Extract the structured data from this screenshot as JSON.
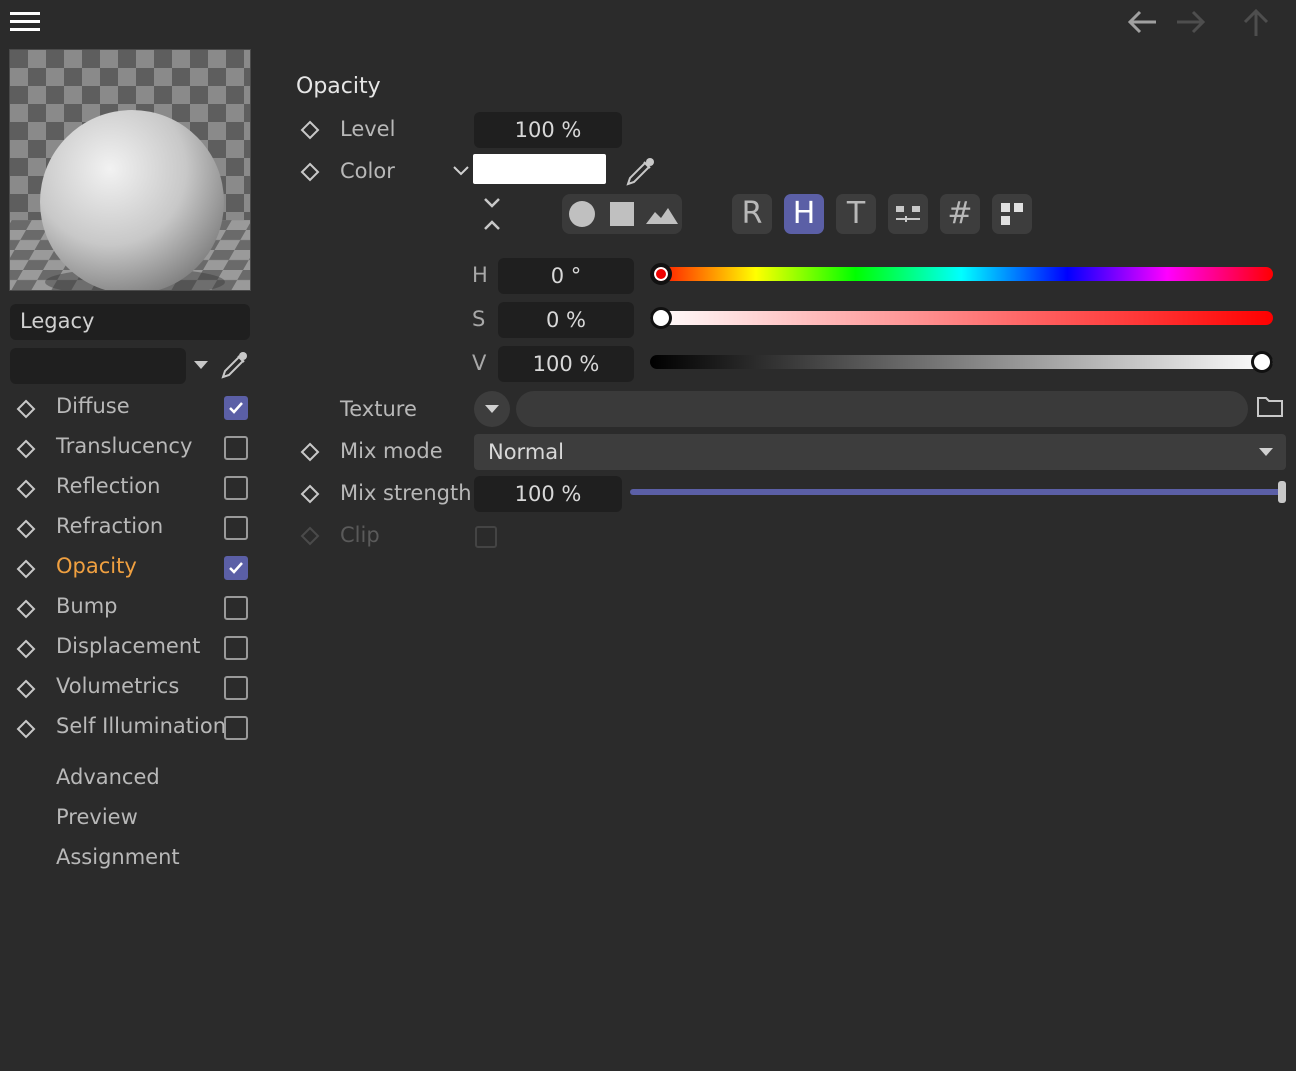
{
  "topbar": {
    "menu_icon": "hamburger-menu-icon",
    "back_icon": "arrow-left-icon",
    "forward_icon": "arrow-right-icon",
    "up_icon": "arrow-up-icon"
  },
  "material": {
    "type_label": "Legacy",
    "name_value": ""
  },
  "channels": [
    {
      "label": "Diffuse",
      "checked": true
    },
    {
      "label": "Translucency",
      "checked": false
    },
    {
      "label": "Reflection",
      "checked": false
    },
    {
      "label": "Refraction",
      "checked": false
    },
    {
      "label": "Opacity",
      "checked": true,
      "active": true
    },
    {
      "label": "Bump",
      "checked": false
    },
    {
      "label": "Displacement",
      "checked": false
    },
    {
      "label": "Volumetrics",
      "checked": false
    },
    {
      "label": "Self Illumination",
      "checked": false
    }
  ],
  "extra_sections": [
    "Advanced",
    "Preview",
    "Assignment"
  ],
  "panel": {
    "title": "Opacity",
    "level_label": "Level",
    "level_value": "100 %",
    "color_label": "Color",
    "color_hex": "#ffffff",
    "mode_buttons": [
      "R",
      "H",
      "T",
      "#"
    ],
    "active_mode": "H",
    "hsv": {
      "h_label": "H",
      "h_value": "0 °",
      "s_label": "S",
      "s_value": "0 %",
      "v_label": "V",
      "v_value": "100 %",
      "h_fraction": 0.0,
      "s_fraction": 0.0,
      "v_fraction": 1.0
    },
    "texture_label": "Texture",
    "texture_value": "",
    "mix_mode_label": "Mix mode",
    "mix_mode_value": "Normal",
    "mix_strength_label": "Mix strength",
    "mix_strength_value": "100 %",
    "mix_strength_fraction": 1.0,
    "clip_label": "Clip",
    "clip_checked": false
  },
  "colors": {
    "background": "#2b2b2b",
    "accent": "#5b5fa6",
    "active_channel": "#f0a040"
  }
}
